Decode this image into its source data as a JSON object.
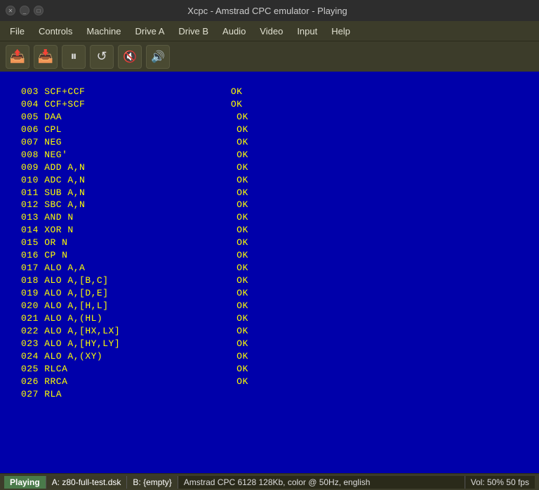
{
  "titlebar": {
    "title": "Xcpc - Amstrad CPC emulator - Playing",
    "close_label": "✕",
    "minimize_label": "_",
    "restore_label": "□"
  },
  "menubar": {
    "items": [
      {
        "label": "File"
      },
      {
        "label": "Controls"
      },
      {
        "label": "Machine"
      },
      {
        "label": "Drive A"
      },
      {
        "label": "Drive B"
      },
      {
        "label": "Audio"
      },
      {
        "label": "Video"
      },
      {
        "label": "Input"
      },
      {
        "label": "Help"
      }
    ]
  },
  "toolbar": {
    "buttons": [
      {
        "name": "upload-button",
        "icon": "⬆",
        "title": "Load snapshot"
      },
      {
        "name": "download-button",
        "icon": "⬇",
        "title": "Save snapshot"
      },
      {
        "name": "pause-button",
        "icon": "⏸",
        "title": "Pause"
      },
      {
        "name": "reset-button",
        "icon": "↺",
        "title": "Reset"
      },
      {
        "name": "volume-mute-button",
        "icon": "🔇",
        "title": "Mute"
      },
      {
        "name": "volume-up-button",
        "icon": "🔊",
        "title": "Volume up"
      }
    ]
  },
  "screen": {
    "content": "003 SCF+CCF                         OK\n004 CCF+SCF                         OK\n005 DAA                              OK\n006 CPL                              OK\n007 NEG                              OK\n008 NEG'                             OK\n009 ADD A,N                          OK\n010 ADC A,N                          OK\n011 SUB A,N                          OK\n012 SBC A,N                          OK\n013 AND N                            OK\n014 XOR N                            OK\n015 OR N                             OK\n016 CP N                             OK\n017 ALO A,A                          OK\n018 ALO A,[B,C]                      OK\n019 ALO A,[D,E]                      OK\n020 ALO A,[H,L]                      OK\n021 ALO A,(HL)                       OK\n022 ALO A,[HX,LX]                    OK\n023 ALO A,[HY,LY]                    OK\n024 ALO A,(XY)                       OK\n025 RLCA                             OK\n026 RRCA                             OK\n027 RLA"
  },
  "statusbar": {
    "playing": "Playing",
    "drive_a": "A: z80-full-test.dsk",
    "drive_b": "B: {empty}",
    "machine": "Amstrad CPC 6128 128Kb, color @ 50Hz, english",
    "volume": "Vol: 50%  50 fps"
  }
}
